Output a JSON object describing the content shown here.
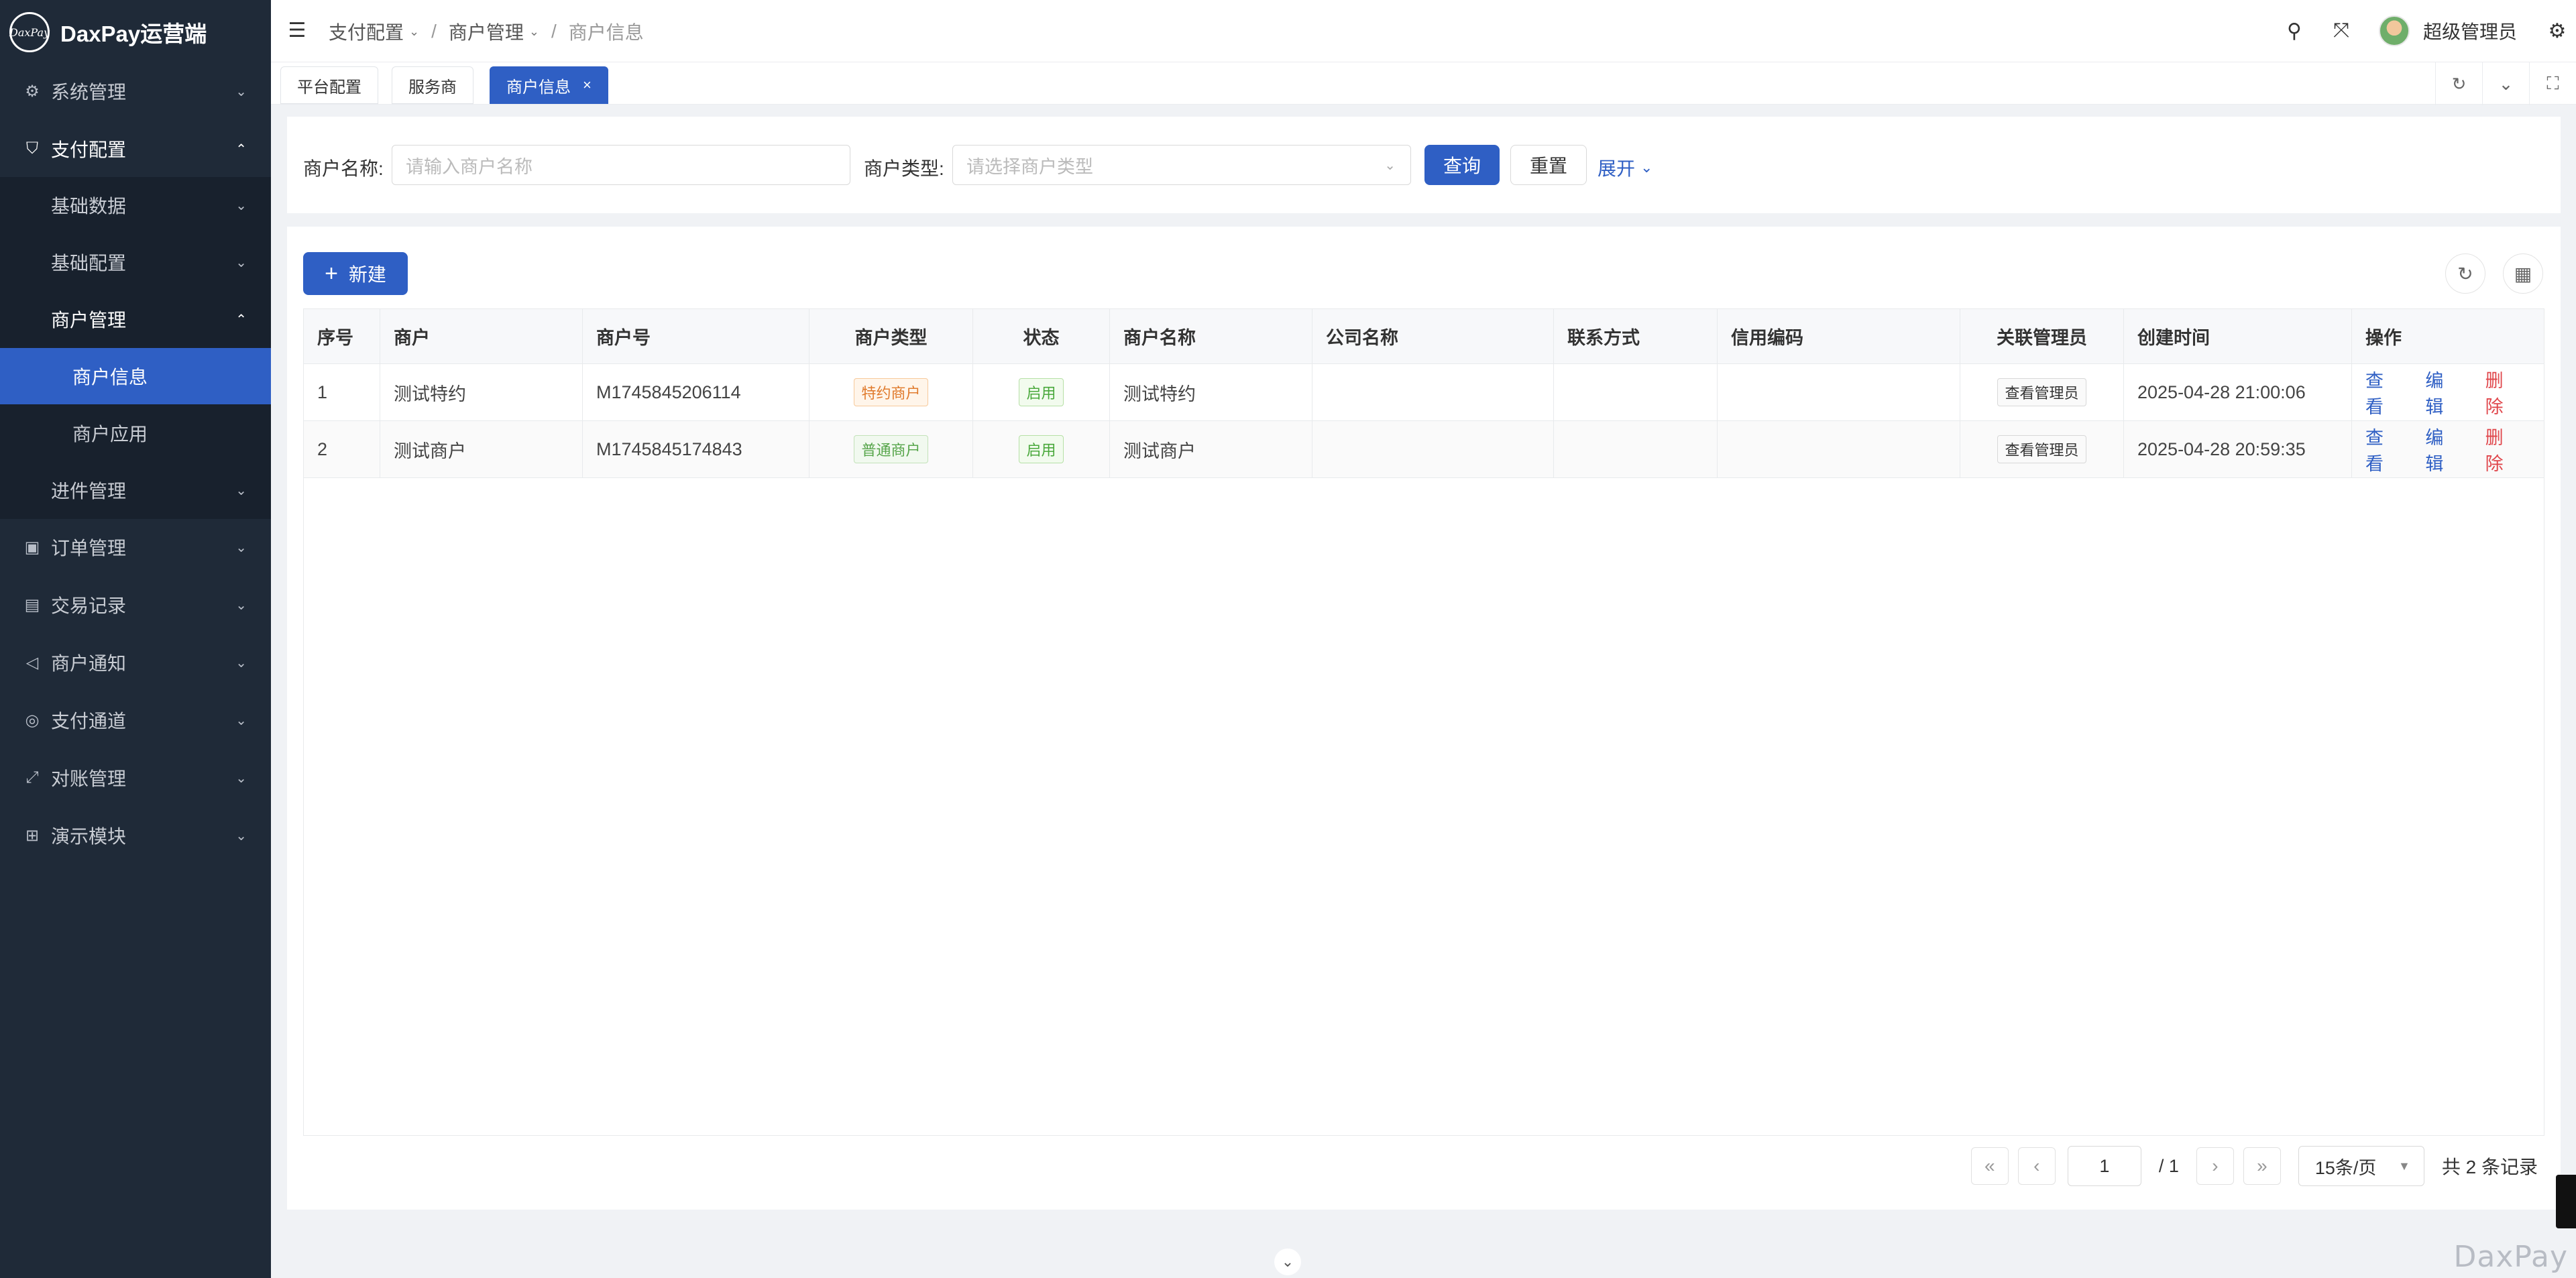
{
  "app": {
    "logo_mark": "DaxPay",
    "title": "DaxPay运营端"
  },
  "sidebar": {
    "items": [
      {
        "label": "系统管理",
        "icon": "gear-icon"
      },
      {
        "label": "支付配置",
        "icon": "shield-icon"
      },
      {
        "label": "基础数据"
      },
      {
        "label": "基础配置"
      },
      {
        "label": "商户管理"
      },
      {
        "label": "商户信息"
      },
      {
        "label": "商户应用"
      },
      {
        "label": "进件管理"
      },
      {
        "label": "订单管理",
        "icon": "wallet-icon"
      },
      {
        "label": "交易记录",
        "icon": "receipt-icon"
      },
      {
        "label": "商户通知",
        "icon": "megaphone-icon"
      },
      {
        "label": "支付通道",
        "icon": "channel-icon"
      },
      {
        "label": "对账管理",
        "icon": "reconcile-icon"
      },
      {
        "label": "演示模块",
        "icon": "grid-icon"
      }
    ]
  },
  "header": {
    "breadcrumb": [
      "支付配置",
      "商户管理",
      "商户信息"
    ],
    "user_name": "超级管理员"
  },
  "tabs": [
    {
      "label": "平台配置"
    },
    {
      "label": "服务商"
    },
    {
      "label": "商户信息",
      "active": true
    }
  ],
  "search": {
    "name_label": "商户名称:",
    "name_placeholder": "请输入商户名称",
    "type_label": "商户类型:",
    "type_placeholder": "请选择商户类型",
    "query_label": "查询",
    "reset_label": "重置",
    "expand_label": "展开"
  },
  "toolbar": {
    "new_label": "新建"
  },
  "table": {
    "columns": [
      "序号",
      "商户",
      "商户号",
      "商户类型",
      "状态",
      "商户名称",
      "公司名称",
      "联系方式",
      "信用编码",
      "关联管理员",
      "创建时间",
      "操作"
    ],
    "rows": [
      {
        "index": "1",
        "merchant": "测试特约",
        "merchant_no": "M1745845206114",
        "type": "特约商户",
        "status": "启用",
        "merchant_name": "测试特约",
        "company": "",
        "contact": "",
        "credit_code": "",
        "admin_btn": "查看管理员",
        "created": "2025-04-28 21:00:06"
      },
      {
        "index": "2",
        "merchant": "测试商户",
        "merchant_no": "M1745845174843",
        "type": "普通商户",
        "status": "启用",
        "merchant_name": "测试商户",
        "company": "",
        "contact": "",
        "credit_code": "",
        "admin_btn": "查看管理员",
        "created": "2025-04-28 20:59:35"
      }
    ],
    "actions": {
      "view": "查看",
      "edit": "编辑",
      "delete": "删除"
    }
  },
  "pager": {
    "page": "1",
    "total_pages": "/ 1",
    "page_size": "15条/页",
    "total_records": "共 2 条记录"
  },
  "watermark": "DaxPay",
  "colors": {
    "primary": "#2f5fc4",
    "sidebar_bg": "#1f2a38",
    "danger": "#e0464b"
  }
}
